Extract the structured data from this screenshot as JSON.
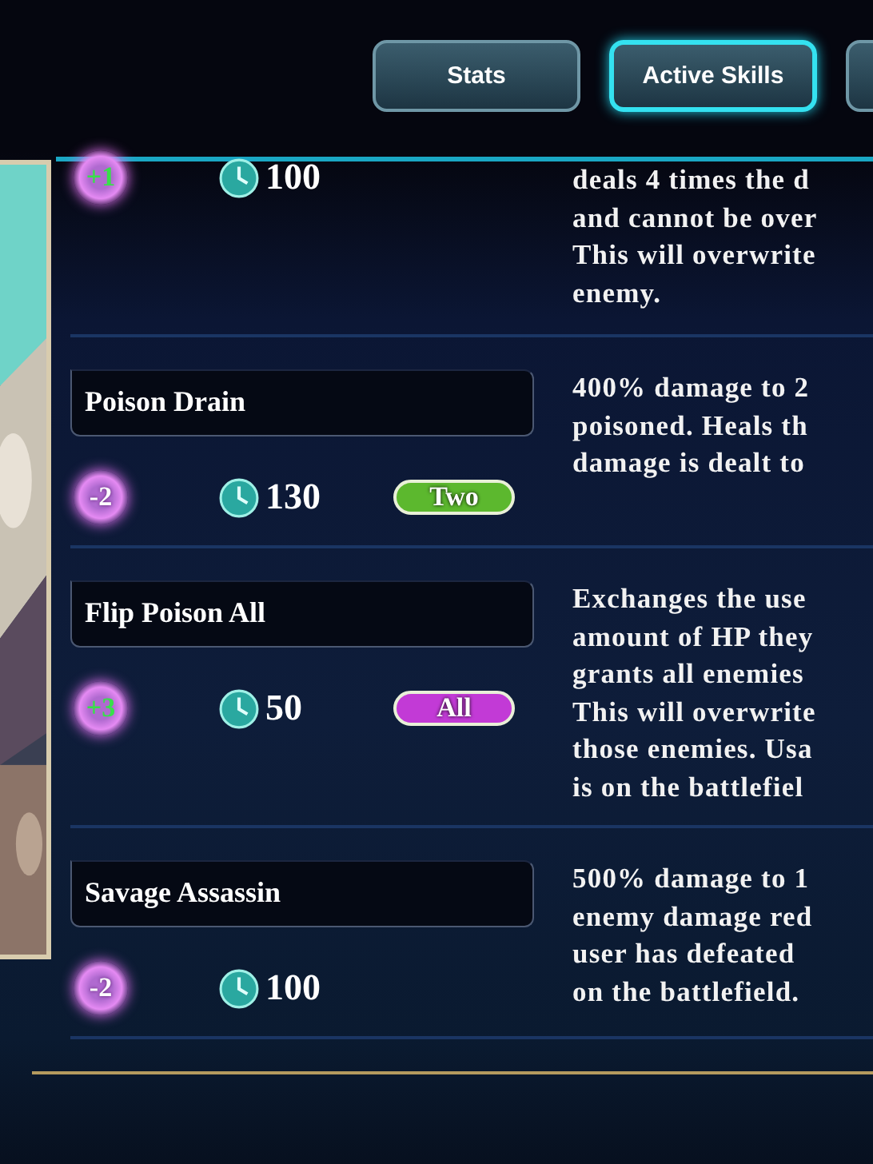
{
  "tabs": [
    {
      "label": "Stats",
      "selected": false
    },
    {
      "label": "Active Skills",
      "selected": true
    }
  ],
  "skills": [
    {
      "kind": "partial",
      "sp": "+1",
      "sp_gain": true,
      "cooldown": "100",
      "description": [
        "deals 4 times the d",
        "and cannot be over",
        "This will overwrite",
        "enemy."
      ]
    },
    {
      "kind": "full",
      "name": "Poison Drain",
      "sp": "-2",
      "sp_gain": false,
      "cooldown": "130",
      "target": {
        "label": "Two",
        "color": "#5cb82e"
      },
      "description": [
        "400% damage to 2",
        "poisoned. Heals th",
        "damage is dealt to"
      ]
    },
    {
      "kind": "full",
      "name": "Flip Poison All",
      "sp": "+3",
      "sp_gain": true,
      "cooldown": "50",
      "target": {
        "label": "All",
        "color": "#c23ad6"
      },
      "description": [
        "Exchanges the use",
        "amount of HP they",
        "grants all enemies",
        "This will overwrite",
        "those enemies. Usa",
        "is on the battlefiel"
      ]
    },
    {
      "kind": "full",
      "name": "Savage Assassin",
      "sp": "-2",
      "sp_gain": false,
      "cooldown": "100",
      "description": [
        "500% damage to 1",
        "enemy damage red",
        "user has defeated",
        "on the battlefield."
      ]
    }
  ]
}
